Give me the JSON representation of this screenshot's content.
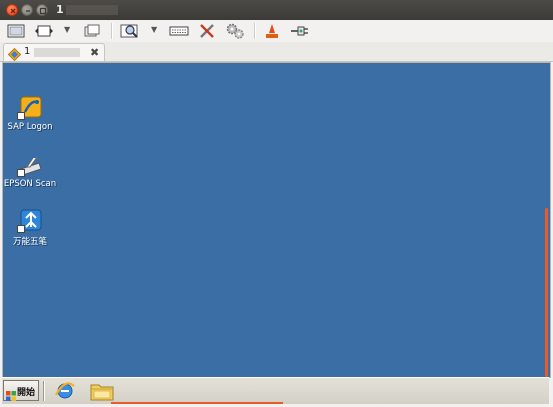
{
  "window": {
    "title": "1",
    "close_icon": "close-icon",
    "minimize_icon": "minimize-icon",
    "maximize_icon": "maximize-icon"
  },
  "toolbar": {
    "icons": [
      "fullscreen-icon",
      "move-icon",
      "windows-icon",
      "zoom-icon",
      "keyboard-icon",
      "tools-icon",
      "settings-icon",
      "record-icon",
      "plug-icon"
    ]
  },
  "tabs": [
    {
      "label": "1",
      "icon": "remote-session-icon",
      "close": "✖"
    }
  ],
  "desktop": {
    "background": "#3a6ea5",
    "icons": [
      {
        "label": "SAP Logon",
        "icon": "sap-logon-icon"
      },
      {
        "label": "EPSON Scan",
        "icon": "epson-scan-icon"
      },
      {
        "label": "万能五笔",
        "icon": "wanneng-wubi-icon"
      }
    ]
  },
  "taskbar": {
    "start_label": "開始",
    "quick_launch": [
      "internet-explorer-icon",
      "folder-icon"
    ]
  },
  "colors": {
    "accent": "#e85c2b",
    "titlebar": "#3b3a36",
    "desktop": "#3a6ea5"
  }
}
